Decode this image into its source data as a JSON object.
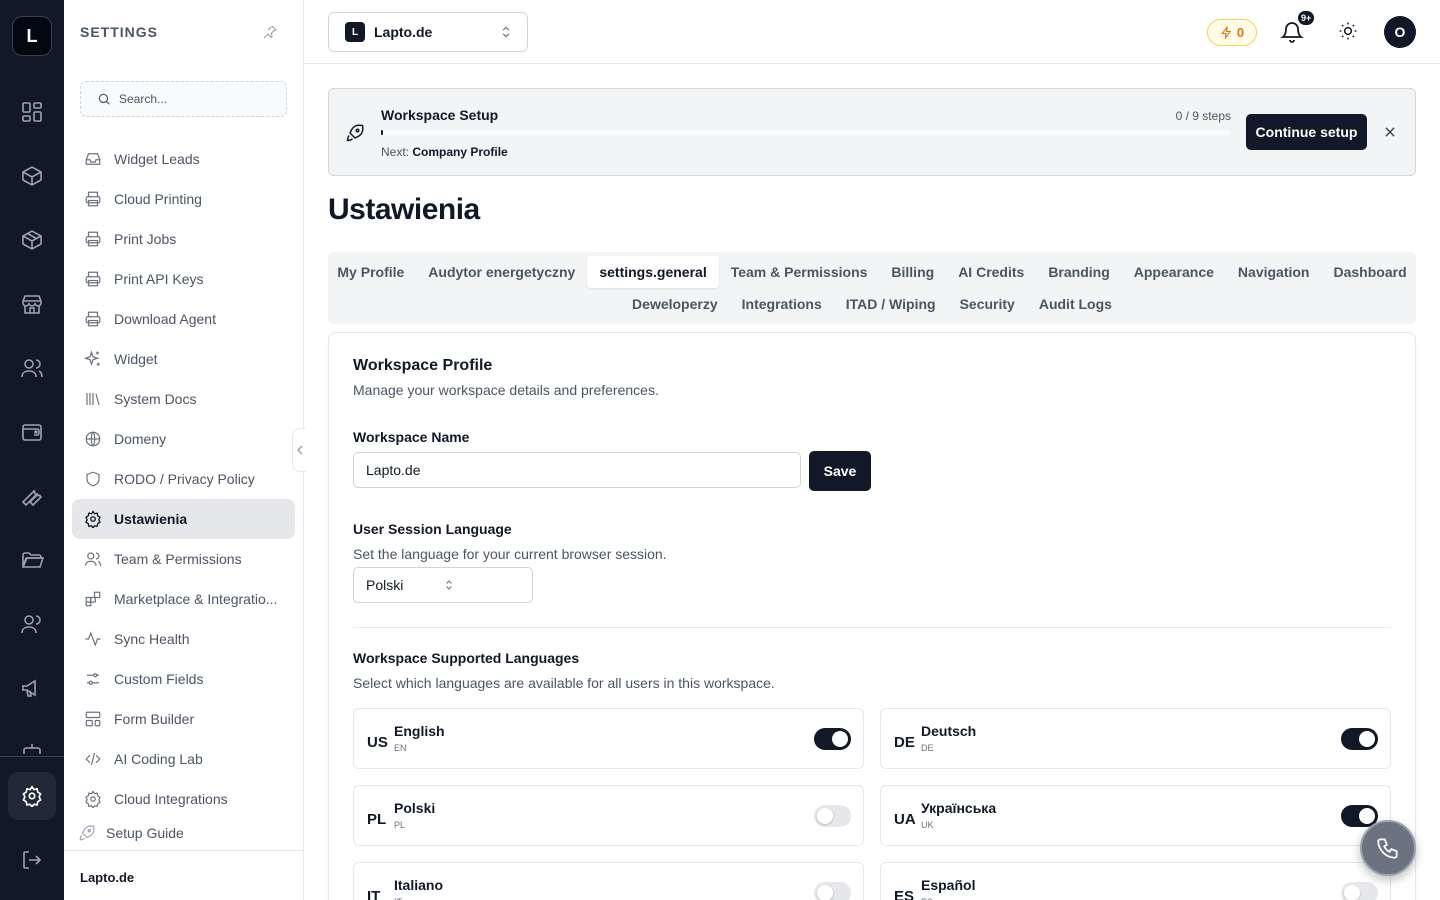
{
  "rail": {
    "logo_letter": "L"
  },
  "sidebar": {
    "title": "SETTINGS",
    "search_placeholder": "Search...",
    "items": [
      {
        "label": "Widget Leads",
        "icon": "inbox-icon"
      },
      {
        "label": "Cloud Printing",
        "icon": "printer-icon"
      },
      {
        "label": "Print Jobs",
        "icon": "printer-icon"
      },
      {
        "label": "Print API Keys",
        "icon": "printer-icon"
      },
      {
        "label": "Download Agent",
        "icon": "printer-icon"
      },
      {
        "label": "Widget",
        "icon": "sparkles-icon"
      },
      {
        "label": "System Docs",
        "icon": "library-icon"
      },
      {
        "label": "Domeny",
        "icon": "globe-icon"
      },
      {
        "label": "RODO / Privacy Policy",
        "icon": "shield-icon"
      },
      {
        "label": "Ustawienia",
        "icon": "gear-icon",
        "active": true
      },
      {
        "label": "Team & Permissions",
        "icon": "users-icon"
      },
      {
        "label": "Marketplace & Integratio...",
        "icon": "blocks-icon"
      },
      {
        "label": "Sync Health",
        "icon": "activity-icon"
      },
      {
        "label": "Custom Fields",
        "icon": "sliders-icon"
      },
      {
        "label": "Form Builder",
        "icon": "layout-icon"
      },
      {
        "label": "AI Coding Lab",
        "icon": "code-icon"
      },
      {
        "label": "Cloud Integrations",
        "icon": "gear-icon"
      }
    ],
    "setup_guide": "Setup Guide",
    "footer": "Lapto.de"
  },
  "header": {
    "workspace_badge": "L",
    "workspace_name": "Lapto.de",
    "credits": "0",
    "notif_count": "9+",
    "avatar_letter": "O"
  },
  "banner": {
    "title": "Workspace Setup",
    "steps": "0 / 9 steps",
    "progress_fraction": 0.0,
    "next_label": "Next:",
    "next_value": "Company Profile",
    "button": "Continue setup"
  },
  "page": {
    "title": "Ustawienia"
  },
  "tabs": {
    "row1": [
      "My Profile",
      "Audytor energetyczny",
      "settings.general",
      "Team & Permissions",
      "Billing",
      "AI Credits",
      "Branding",
      "Appearance",
      "Navigation",
      "Dashboard"
    ],
    "row2": [
      "Deweloperzy",
      "Integrations",
      "ITAD / Wiping",
      "Security",
      "Audit Logs"
    ],
    "active": "settings.general"
  },
  "profile": {
    "title": "Workspace Profile",
    "desc": "Manage your workspace details and preferences.",
    "name_label": "Workspace Name",
    "name_value": "Lapto.de",
    "save": "Save",
    "session_label": "User Session Language",
    "session_desc": "Set the language for your current browser session.",
    "session_value": "Polski",
    "supported_label": "Workspace Supported Languages",
    "supported_desc": "Select which languages are available for all users in this workspace.",
    "languages": [
      {
        "code": "US",
        "name": "English",
        "iso": "EN",
        "enabled": true
      },
      {
        "code": "DE",
        "name": "Deutsch",
        "iso": "DE",
        "enabled": true
      },
      {
        "code": "PL",
        "name": "Polski",
        "iso": "PL",
        "enabled": false
      },
      {
        "code": "UA",
        "name": "Українська",
        "iso": "UK",
        "enabled": true
      },
      {
        "code": "IT",
        "name": "Italiano",
        "iso": "IT",
        "enabled": false
      },
      {
        "code": "ES",
        "name": "Español",
        "iso": "ES",
        "enabled": false
      }
    ]
  },
  "colors": {
    "primary": "#111827",
    "accent_warning": "#d97706",
    "rail_bg": "#111827"
  }
}
